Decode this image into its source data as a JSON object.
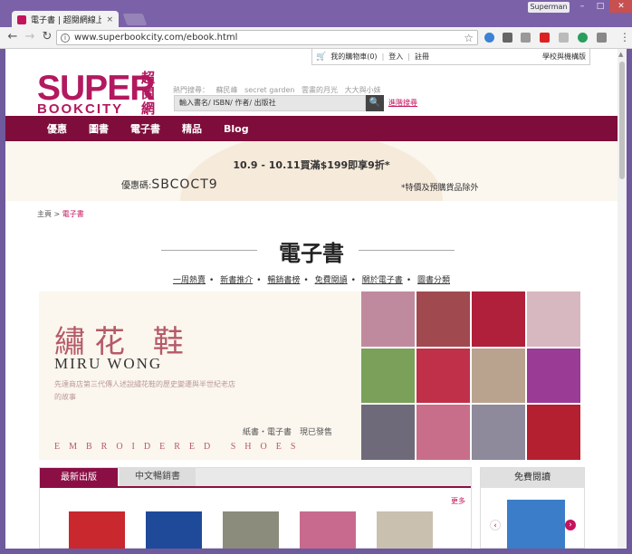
{
  "browser": {
    "tab_title": "電子書 | 超閱網線上書店",
    "tab_close": "×",
    "user": "Superman",
    "url": "www.superbookcity.com/ebook.html",
    "win_min": "–",
    "win_max": "□",
    "win_close": "✕",
    "nav_back": "←",
    "nav_forward": "→",
    "nav_reload": "↻",
    "star": "☆",
    "info": "i",
    "menu": "⋮"
  },
  "site": {
    "logo_main": "SUPER",
    "logo_sub": "BOOKCITY",
    "logo_cjk": "超閱網",
    "cart_icon": "🛒",
    "cart_label": "我的購物車(0)",
    "login": "登入",
    "register": "註冊",
    "institution": "學校與機構版",
    "hot_search_label": "熱門搜尋：",
    "hot_terms": [
      "蘇民峰",
      "secret garden",
      "雲畫的月光",
      "大大與小妹"
    ],
    "search_placeholder": "輸入書名/ ISBN/ 作者/ 出版社",
    "search_btn": "🔍",
    "advanced_search": "進階搜尋"
  },
  "nav": [
    "優惠",
    "圖書",
    "電子書",
    "精品",
    "Blog"
  ],
  "promo": {
    "title": "10.9 - 10.11買滿$199即享9折*",
    "code_label": "優惠碼:",
    "code": "SBCOCT9",
    "note": "*特價及預購貨品除外"
  },
  "breadcrumb": {
    "home": "主頁",
    "sep": ">",
    "current": "電子書"
  },
  "page_title": "電子書",
  "sublinks": [
    "一周熱賣",
    "新書推介",
    "暢銷書榜",
    "免費閱讀",
    "關於電子書",
    "圖書分類"
  ],
  "banner": {
    "title": "繡花 鞋",
    "name": "MIRU WONG",
    "desc": "先達商店第三代傳人述說繡花鞋的歷史變遷與半世紀老店的故事",
    "pub": "紙書・電子書　現已發售",
    "english": "EMBROIDERED SHOES"
  },
  "tabs": {
    "active": "最新出版",
    "inactive": "中文暢銷書",
    "more": "更多"
  },
  "free_read": {
    "title": "免費閱讀",
    "prev": "‹",
    "next": "›"
  },
  "colors": {
    "brand": "#b2195f",
    "nav_bg": "#7e0d3b",
    "tab_active": "#8b0f45",
    "link": "#c4145e"
  }
}
